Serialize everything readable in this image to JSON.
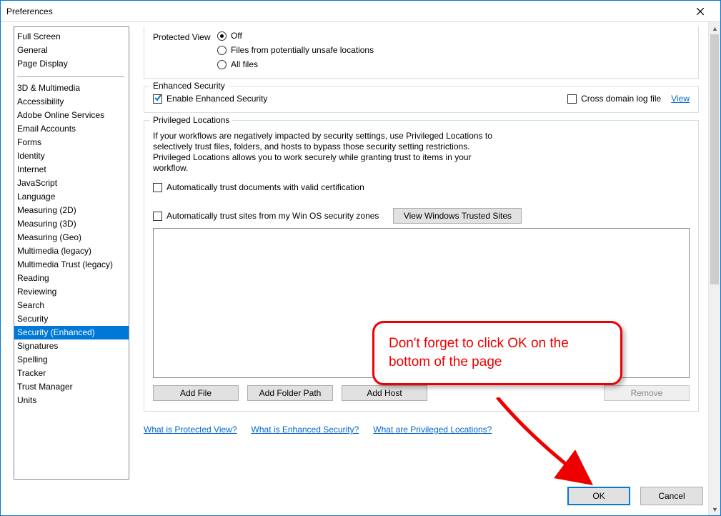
{
  "window": {
    "title": "Preferences"
  },
  "categories_top": [
    "Full Screen",
    "General",
    "Page Display"
  ],
  "categories_main": [
    "3D & Multimedia",
    "Accessibility",
    "Adobe Online Services",
    "Email Accounts",
    "Forms",
    "Identity",
    "Internet",
    "JavaScript",
    "Language",
    "Measuring (2D)",
    "Measuring (3D)",
    "Measuring (Geo)",
    "Multimedia (legacy)",
    "Multimedia Trust (legacy)",
    "Reading",
    "Reviewing",
    "Search",
    "Security",
    "Security (Enhanced)",
    "Signatures",
    "Spelling",
    "Tracker",
    "Trust Manager",
    "Units"
  ],
  "selected_category": "Security (Enhanced)",
  "protected_view": {
    "legend": "Protected View",
    "options": [
      "Off",
      "Files from potentially unsafe locations",
      "All files"
    ],
    "selected": "Off"
  },
  "enhanced_security": {
    "legend": "Enhanced Security",
    "enable_label": "Enable Enhanced Security",
    "enable_checked": true,
    "cross_domain_label": "Cross domain log file",
    "cross_domain_checked": false,
    "view_link": "View"
  },
  "privileged": {
    "legend": "Privileged Locations",
    "description": "If your workflows are negatively impacted by security settings, use Privileged Locations to selectively trust files, folders, and hosts to bypass those security setting restrictions. Privileged Locations allows you to work securely while granting trust to items in your workflow.",
    "auto_trust_cert_label": "Automatically trust documents with valid certification",
    "auto_trust_cert_checked": false,
    "auto_trust_sites_label": "Automatically trust sites from my Win OS security zones",
    "auto_trust_sites_checked": false,
    "view_trusted_button": "View Windows Trusted Sites",
    "add_file": "Add File",
    "add_folder": "Add Folder Path",
    "add_host": "Add Host",
    "remove": "Remove"
  },
  "help_links": {
    "pv": "What is Protected View?",
    "es": "What is Enhanced Security?",
    "pl": "What are Privileged Locations?"
  },
  "dialog": {
    "ok": "OK",
    "cancel": "Cancel"
  },
  "annotation": {
    "text": "Don't forget to click OK on the bottom of the page"
  }
}
